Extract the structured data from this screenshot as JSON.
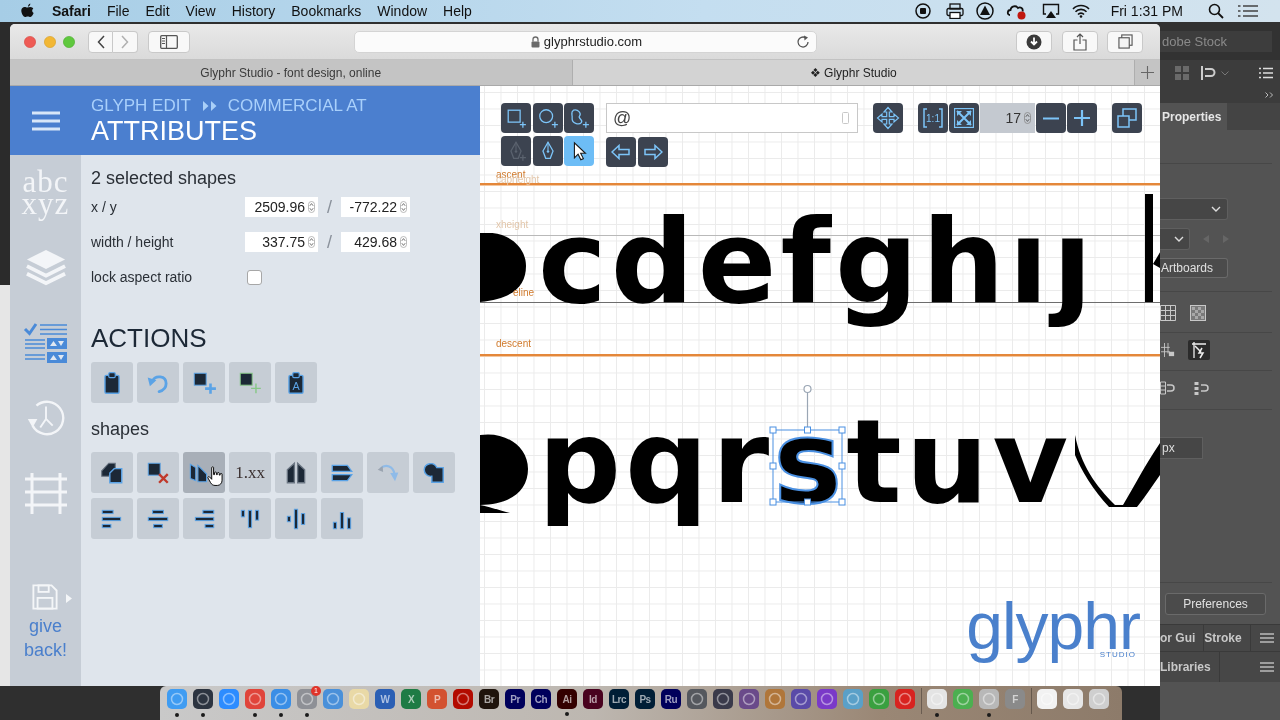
{
  "menu_bar": {
    "app_name": "Safari",
    "menus": [
      "File",
      "Edit",
      "View",
      "History",
      "Bookmarks",
      "Window",
      "Help"
    ],
    "clock": "Fri 1:31 PM"
  },
  "browser": {
    "address": "glyphrstudio.com",
    "tabs": [
      {
        "title": "Glyphr Studio - font design, online",
        "selected": false
      },
      {
        "title": "❖ Glyphr Studio",
        "selected": true
      }
    ]
  },
  "glyphr": {
    "nav": {
      "items": [
        {
          "kind": "characters",
          "lines": [
            "abc",
            "xyz"
          ],
          "selected": false
        },
        {
          "kind": "layers",
          "selected": false
        },
        {
          "kind": "attributes",
          "selected": true
        },
        {
          "kind": "history",
          "selected": false
        },
        {
          "kind": "guides",
          "selected": false
        }
      ],
      "give_back": "give back!"
    },
    "header": {
      "breadcrumb": [
        "GLYPH EDIT",
        "COMMERCIAL AT"
      ],
      "title": "ATTRIBUTES"
    },
    "attributes": {
      "selection": "2 selected shapes",
      "rows": [
        {
          "label": "x / y",
          "values": [
            "2509.96",
            "-772.22"
          ],
          "separator": "/"
        },
        {
          "label": "width / height",
          "values": [
            "337.75",
            "429.68"
          ],
          "separator": "/"
        }
      ],
      "lock_aspect_ratio": {
        "label": "lock aspect ratio",
        "checked": false
      }
    },
    "actions": {
      "title": "ACTIONS",
      "buttons": [
        {
          "kind": "paste"
        },
        {
          "kind": "undo"
        },
        {
          "kind": "add-shape"
        },
        {
          "kind": "add-component"
        },
        {
          "kind": "paste-glyph",
          "label": "A"
        }
      ]
    },
    "shapes": {
      "title": "shapes",
      "buttons": [
        {
          "kind": "copy",
          "hovered": false
        },
        {
          "kind": "delete",
          "hovered": false
        },
        {
          "kind": "reverse",
          "hovered": true
        },
        {
          "kind": "round",
          "label": "1.xx",
          "hovered": false
        },
        {
          "kind": "flip-horizontal",
          "hovered": false
        },
        {
          "kind": "flip-vertical",
          "hovered": false
        },
        {
          "kind": "rotate",
          "hovered": false
        },
        {
          "kind": "combine",
          "hovered": false
        }
      ],
      "align_buttons": [
        {
          "kind": "align-left"
        },
        {
          "kind": "align-center"
        },
        {
          "kind": "align-right"
        },
        {
          "kind": "align-top"
        },
        {
          "kind": "align-middle"
        },
        {
          "kind": "align-bottom"
        }
      ]
    },
    "canvas": {
      "tools": [
        {
          "kind": "rectangle",
          "selected": false,
          "disabled": false
        },
        {
          "kind": "oval",
          "selected": false,
          "disabled": false
        },
        {
          "kind": "path",
          "selected": false,
          "disabled": false
        },
        {
          "kind": "pen-plus",
          "selected": false,
          "disabled": true
        },
        {
          "kind": "pen",
          "selected": false,
          "disabled": false
        },
        {
          "kind": "pointer",
          "selected": true,
          "disabled": false
        }
      ],
      "glyph_field": {
        "value": "@"
      },
      "actual_size_label": "1:1",
      "zoom_field": {
        "value": "17"
      },
      "guides": [
        {
          "kind": "ascent",
          "label": "ascent"
        },
        {
          "kind": "capheight",
          "label": "capheight"
        },
        {
          "kind": "xheight",
          "label": "xheight"
        },
        {
          "kind": "baseline",
          "label": "eline"
        },
        {
          "kind": "descent",
          "label": "descent"
        }
      ],
      "glyph_rows": [
        {
          "glyphs": [
            {
              "char": "c",
              "selected": false
            },
            {
              "char": "d",
              "selected": false
            },
            {
              "char": "e",
              "selected": false
            },
            {
              "char": "f",
              "selected": false
            },
            {
              "char": "g",
              "selected": false
            },
            {
              "char": "h",
              "selected": false
            },
            {
              "char": "ı",
              "selected": false
            },
            {
              "char": "ȷ",
              "selected": false
            }
          ]
        },
        {
          "glyphs": [
            {
              "char": "p",
              "selected": false
            },
            {
              "char": "q",
              "selected": false
            },
            {
              "char": "r",
              "selected": false
            },
            {
              "char": "s",
              "selected": true
            },
            {
              "char": "t",
              "selected": false
            },
            {
              "char": "u",
              "selected": false
            },
            {
              "char": "v",
              "selected": false
            }
          ]
        }
      ],
      "logo": {
        "name": "glyphr",
        "tagline": "STUDIO"
      }
    }
  },
  "illustrator": {
    "search": {
      "placeholder": "dobe Stock"
    },
    "tabs": [
      {
        "label": "Properties",
        "selected": true
      }
    ],
    "artboards_button": "Artboards",
    "unit_field": {
      "value": "px"
    },
    "preferences_button": "Preferences",
    "bottom_tabs": [
      {
        "label": "or Gui"
      },
      {
        "label": "Stroke"
      }
    ],
    "libraries_tab": "Libraries"
  },
  "dock": {
    "items": [
      {
        "kind": "icon",
        "color": "#3f9cf2",
        "running": true
      },
      {
        "kind": "icon",
        "color": "#2c3440",
        "running": true
      },
      {
        "kind": "icon",
        "color": "#2d8cff",
        "running": false
      },
      {
        "kind": "icon",
        "color": "#e0443a",
        "running": true
      },
      {
        "kind": "icon",
        "color": "#3a8ee6",
        "running": true
      },
      {
        "kind": "icon",
        "color": "#8e9096",
        "running": true,
        "badge": "1"
      },
      {
        "kind": "icon",
        "color": "#4a90d9",
        "running": false
      },
      {
        "kind": "icon",
        "color": "#e9d9a6",
        "running": false
      },
      {
        "kind": "tile",
        "label": "W",
        "color": "#2b5fb4",
        "running": false
      },
      {
        "kind": "tile",
        "label": "X",
        "color": "#1e7b45",
        "running": false
      },
      {
        "kind": "tile",
        "label": "P",
        "color": "#d35230",
        "running": false
      },
      {
        "kind": "icon",
        "color": "#b30b00",
        "running": false
      },
      {
        "kind": "tile",
        "label": "Br",
        "color": "#1f140c",
        "running": false
      },
      {
        "kind": "tile",
        "label": "Pr",
        "color": "#00005b",
        "running": false
      },
      {
        "kind": "tile",
        "label": "Ch",
        "color": "#00005b",
        "running": false
      },
      {
        "kind": "tile",
        "label": "Ai",
        "color": "#330000",
        "running": true
      },
      {
        "kind": "tile",
        "label": "Id",
        "color": "#49021f",
        "running": false
      },
      {
        "kind": "tile",
        "label": "Lrc",
        "color": "#001e36",
        "running": false
      },
      {
        "kind": "tile",
        "label": "Ps",
        "color": "#001e36",
        "running": false
      },
      {
        "kind": "tile",
        "label": "Ru",
        "color": "#00005b",
        "running": false
      },
      {
        "kind": "icon",
        "color": "#55585e",
        "running": false
      },
      {
        "kind": "icon",
        "color": "#3a3a4a",
        "running": false
      },
      {
        "kind": "icon",
        "color": "#6a4a8a",
        "running": false
      },
      {
        "kind": "icon",
        "color": "#b0763a",
        "running": false
      },
      {
        "kind": "icon",
        "color": "#5a4aa8",
        "running": false
      },
      {
        "kind": "icon",
        "color": "#7a3ac8",
        "running": false
      },
      {
        "kind": "icon",
        "color": "#5aa0c8",
        "running": false
      },
      {
        "kind": "icon",
        "color": "#3aa040",
        "running": false
      },
      {
        "kind": "icon",
        "color": "#d8231f",
        "running": false
      },
      {
        "kind": "separator"
      },
      {
        "kind": "icon",
        "color": "#e4e4e4",
        "running": true
      },
      {
        "kind": "icon",
        "color": "#4caf50",
        "running": false
      },
      {
        "kind": "icon",
        "color": "#b8b8b8",
        "running": true
      },
      {
        "kind": "tile",
        "label": "F",
        "color": "#8a8a8a",
        "running": false
      },
      {
        "kind": "separator"
      },
      {
        "kind": "icon",
        "color": "#f2f2f2",
        "running": false
      },
      {
        "kind": "icon",
        "color": "#e6e6e6",
        "running": false
      },
      {
        "kind": "icon",
        "color": "#cfcfcf",
        "running": false
      }
    ]
  }
}
